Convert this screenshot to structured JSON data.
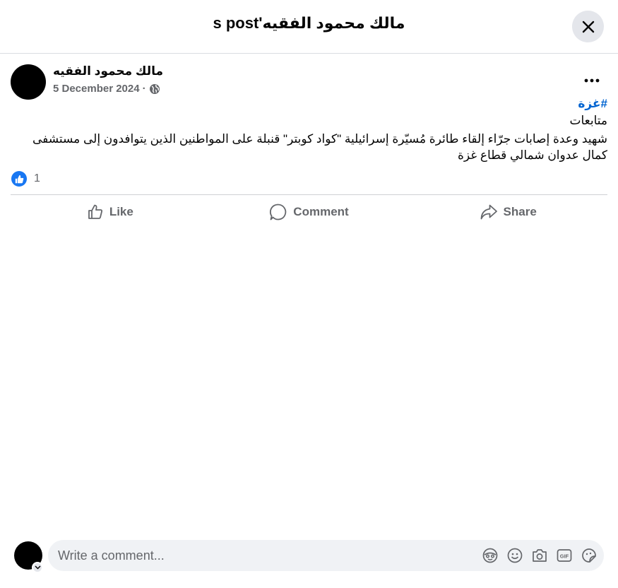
{
  "header": {
    "title": "مالك محمود الفقيه's post"
  },
  "post": {
    "author": "مالك محمود الفقيه",
    "date": "5 December 2024",
    "separator": "·",
    "hashtag": "#غزة",
    "line1": "متابعات",
    "line2": "شهيد وعدة إصابات جرّاء إلقاء طائرة مُسيّرة إسرائيلية \"كواد كوبتر\" قنبلة على المواطنين الذين يتوافدون إلى مستشفى كمال عدوان شمالي قطاع غزة",
    "reaction_count": "1"
  },
  "actions": {
    "like": "Like",
    "comment": "Comment",
    "share": "Share"
  },
  "composer": {
    "placeholder": "Write a comment...",
    "icons": [
      "avatar-sticker-icon",
      "emoji-icon",
      "camera-icon",
      "gif-icon",
      "sticker-icon"
    ]
  },
  "colors": {
    "accent": "#1877f2",
    "hashtag": "#0064d1",
    "muted": "#65676b"
  }
}
